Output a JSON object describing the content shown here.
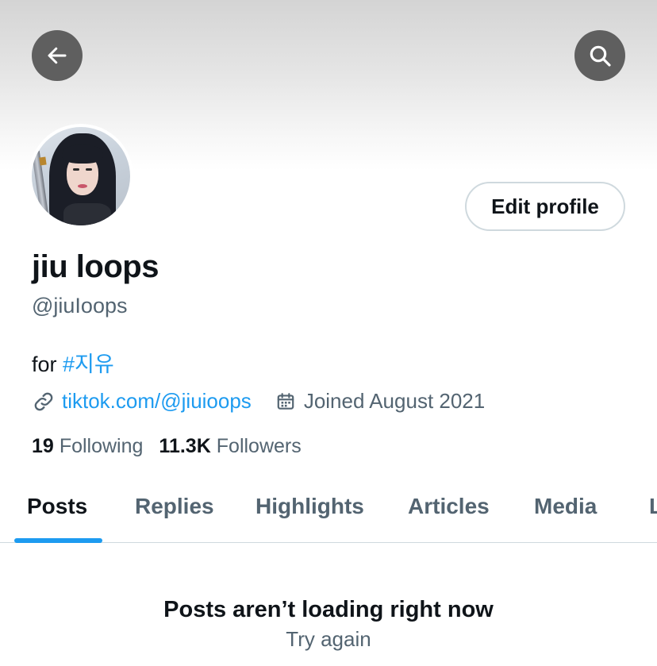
{
  "profile": {
    "display_name": "jiu loops",
    "handle": "@jiuIoops",
    "bio_prefix": "for ",
    "bio_hashtag": "#지유",
    "link": "tiktok.com/@jiuioops",
    "joined": "Joined August 2021",
    "edit_button": "Edit profile"
  },
  "stats": {
    "following_count": "19",
    "following_label": "Following",
    "followers_count": "11.3K",
    "followers_label": "Followers"
  },
  "tabs": [
    {
      "label": "Posts",
      "active": true
    },
    {
      "label": "Replies",
      "active": false
    },
    {
      "label": "Highlights",
      "active": false
    },
    {
      "label": "Articles",
      "active": false
    },
    {
      "label": "Media",
      "active": false
    },
    {
      "label": "L",
      "active": false
    }
  ],
  "error": {
    "title": "Posts aren’t loading right now",
    "retry": "Try again"
  },
  "colors": {
    "accent": "#1d9bf0",
    "text": "#0f1419",
    "secondary": "#536471",
    "nav_button": "#5f5f5f"
  },
  "icons": [
    "back-arrow-icon",
    "search-icon",
    "link-icon",
    "calendar-icon"
  ]
}
